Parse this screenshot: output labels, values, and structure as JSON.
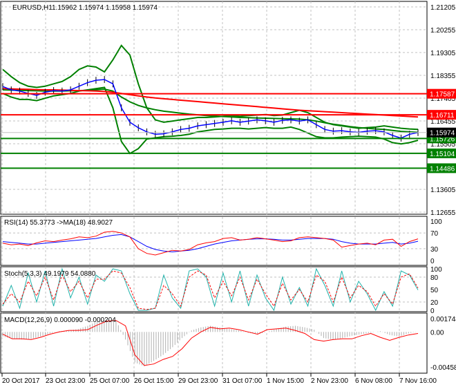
{
  "header": {
    "symbol": "EURUSD,H1",
    "ohlc": "1.15962 1.15974 1.15958 1.15974"
  },
  "chart_data": [
    {
      "type": "line",
      "title": "EURUSD,H1",
      "ylim": [
        1.12655,
        1.21205
      ],
      "yticks": [
        1.21205,
        1.20255,
        1.19305,
        1.18355,
        1.17405,
        1.16455,
        1.15505,
        1.13605,
        1.12655
      ],
      "xlabels": [
        "20 Oct 2017",
        "23 Oct 23:00",
        "25 Oct 07:00",
        "26 Oct 15:00",
        "29 Oct 23:00",
        "31 Oct 07:00",
        "1 Nov 15:00",
        "2 Nov 23:00",
        "6 Nov 08:00",
        "7 Nov 16:00"
      ],
      "close": [
        1.1789,
        1.1775,
        1.177,
        1.176,
        1.1752,
        1.1765,
        1.1772,
        1.177,
        1.1775,
        1.179,
        1.1805,
        1.1815,
        1.1818,
        1.18,
        1.17,
        1.164,
        1.1617,
        1.16,
        1.159,
        1.1592,
        1.16,
        1.161,
        1.1615,
        1.1625,
        1.163,
        1.1635,
        1.164,
        1.1646,
        1.164,
        1.1645,
        1.165,
        1.1646,
        1.164,
        1.1648,
        1.165,
        1.1645,
        1.165,
        1.163,
        1.161,
        1.1603,
        1.1605,
        1.16,
        1.1598,
        1.1603,
        1.1605,
        1.16,
        1.1585,
        1.1574,
        1.159,
        1.1597
      ],
      "bb_upper": [
        1.186,
        1.183,
        1.1805,
        1.179,
        1.1785,
        1.179,
        1.18,
        1.181,
        1.183,
        1.186,
        1.1875,
        1.187,
        1.185,
        1.19,
        1.196,
        1.192,
        1.18,
        1.17,
        1.165,
        1.164,
        1.1645,
        1.165,
        1.1655,
        1.166,
        1.166,
        1.1662,
        1.1665,
        1.1668,
        1.1665,
        1.1668,
        1.167,
        1.1672,
        1.1668,
        1.167,
        1.168,
        1.169,
        1.168,
        1.166,
        1.164,
        1.163,
        1.1625,
        1.162,
        1.1615,
        1.1618,
        1.162,
        1.1625,
        1.162,
        1.1615,
        1.1612,
        1.161
      ],
      "bb_lower": [
        1.176,
        1.1745,
        1.1735,
        1.1735,
        1.173,
        1.174,
        1.175,
        1.1755,
        1.176,
        1.177,
        1.1775,
        1.178,
        1.1785,
        1.17,
        1.156,
        1.151,
        1.153,
        1.157,
        1.1575,
        1.158,
        1.1582,
        1.1585,
        1.159,
        1.16,
        1.1605,
        1.161,
        1.1612,
        1.1615,
        1.1615,
        1.1612,
        1.1615,
        1.1618,
        1.1615,
        1.1615,
        1.162,
        1.161,
        1.1595,
        1.158,
        1.1575,
        1.1575,
        1.1578,
        1.158,
        1.1582,
        1.158,
        1.1578,
        1.157,
        1.1555,
        1.155,
        1.1555,
        1.1565
      ],
      "ma_slow": [
        1.178,
        1.1779,
        1.1778,
        1.1777,
        1.1776,
        1.1775,
        1.1775,
        1.1774,
        1.1773,
        1.1772,
        1.1771,
        1.177,
        1.1768,
        1.1765,
        1.176,
        1.1755,
        1.175,
        1.1745,
        1.1741,
        1.1738,
        1.1735,
        1.1732,
        1.1729,
        1.1726,
        1.1723,
        1.172,
        1.1717,
        1.1714,
        1.1711,
        1.1708,
        1.1705,
        1.1702,
        1.1699,
        1.1696,
        1.1693,
        1.169,
        1.1688,
        1.1686,
        1.1684,
        1.1682,
        1.168,
        1.1678,
        1.1676,
        1.1674,
        1.1672,
        1.167,
        1.1668,
        1.1666,
        1.1664,
        1.1662
      ],
      "ma_green": [
        1.1775,
        1.1774,
        1.1773,
        1.1772,
        1.1771,
        1.177,
        1.177,
        1.177,
        1.1771,
        1.1772,
        1.1773,
        1.1775,
        1.1778,
        1.177,
        1.1745,
        1.1725,
        1.171,
        1.17,
        1.1692,
        1.1686,
        1.1682,
        1.1678,
        1.1674,
        1.1671,
        1.1668,
        1.1666,
        1.1664,
        1.1662,
        1.166,
        1.1659,
        1.1658,
        1.1657,
        1.1656,
        1.1655,
        1.1654,
        1.1653,
        1.165,
        1.1645,
        1.1638,
        1.1632,
        1.1627,
        1.1622,
        1.1618,
        1.1615,
        1.1612,
        1.161,
        1.1606,
        1.1602,
        1.16,
        1.1598
      ],
      "levels": [
        {
          "value": "1.17587",
          "color": "#ff0000"
        },
        {
          "value": "1.16711",
          "color": "#ff0000"
        },
        {
          "value": "1.15726",
          "color": "#008000"
        },
        {
          "value": "1.15104",
          "color": "#008000"
        },
        {
          "value": "1.14486",
          "color": "#008000"
        }
      ],
      "current": {
        "value": "1.15974",
        "color": "#000000"
      }
    },
    {
      "type": "line",
      "title": "RSI(14) 55.3773  ->MA(18) 48.9027",
      "ylim": [
        0,
        100
      ],
      "yticks": [
        "100",
        "70",
        "30",
        "0"
      ],
      "rsi": [
        44,
        40,
        42,
        38,
        45,
        50,
        48,
        52,
        55,
        60,
        58,
        62,
        72,
        74,
        70,
        60,
        30,
        18,
        14,
        20,
        26,
        24,
        28,
        40,
        45,
        48,
        56,
        58,
        52,
        54,
        58,
        55,
        52,
        48,
        50,
        58,
        60,
        58,
        56,
        52,
        34,
        38,
        42,
        44,
        40,
        52,
        54,
        36,
        48,
        55
      ],
      "ma": [
        48,
        46,
        44,
        42,
        42,
        44,
        46,
        48,
        50,
        52,
        54,
        56,
        60,
        64,
        66,
        60,
        48,
        36,
        28,
        24,
        22,
        24,
        26,
        30,
        36,
        42,
        46,
        50,
        52,
        54,
        55,
        55,
        54,
        52,
        52,
        54,
        56,
        56,
        56,
        54,
        48,
        44,
        42,
        42,
        42,
        44,
        46,
        42,
        44,
        49
      ]
    },
    {
      "type": "line",
      "title": "Stoch(5,3,3) 49.1979 54.0880",
      "ylim": [
        0,
        100
      ],
      "yticks": [
        "100",
        "80",
        "50",
        "20",
        "0"
      ],
      "k": [
        10,
        60,
        5,
        90,
        20,
        95,
        10,
        100,
        30,
        80,
        15,
        85,
        70,
        100,
        95,
        40,
        0,
        0,
        5,
        85,
        30,
        5,
        95,
        100,
        80,
        10,
        90,
        20,
        95,
        10,
        85,
        30,
        0,
        80,
        15,
        55,
        10,
        100,
        60,
        10,
        95,
        20,
        70,
        40,
        0,
        45,
        10,
        95,
        85,
        49
      ],
      "d": [
        15,
        40,
        20,
        70,
        35,
        80,
        25,
        85,
        45,
        70,
        30,
        75,
        75,
        95,
        90,
        55,
        5,
        2,
        5,
        60,
        40,
        10,
        80,
        95,
        85,
        30,
        70,
        35,
        80,
        25,
        75,
        40,
        10,
        65,
        25,
        50,
        20,
        85,
        70,
        20,
        80,
        30,
        60,
        45,
        10,
        40,
        15,
        80,
        88,
        54
      ]
    },
    {
      "type": "bar",
      "title": "MACD(12,26,9) 0.000090 -0.000204",
      "ylim": [
        -0.004586,
        0.001748
      ],
      "yticks": [
        "0.001748",
        "0.00",
        "-0.004586"
      ],
      "hist": [
        -0.0006,
        -0.0009,
        -0.001,
        -0.0009,
        -0.0006,
        -0.0002,
        0.0001,
        0.0002,
        0.0004,
        0.0008,
        0.0014,
        0.0016,
        0.0015,
        -0.001,
        -0.004,
        -0.0045,
        -0.0038,
        -0.003,
        -0.002,
        -0.0008,
        0.0002,
        0.0006,
        0.0008,
        0.0006,
        0.0004,
        0.0002,
        -0.0001,
        -0.0003,
        0.0,
        0.0004,
        0.0007,
        0.0008,
        0.0006,
        0.0003,
        -0.0008,
        -0.001,
        -0.0008,
        -0.0005,
        -0.0003,
        -0.0001,
        0.0001,
        -0.0004,
        -0.0006,
        -0.0002,
        0.0001
      ],
      "signal": [
        -0.0003,
        -0.0009,
        -0.0009,
        -0.001,
        -0.0007,
        -0.0003,
        0.0,
        0.0002,
        0.0002,
        0.0003,
        0.0009,
        0.0014,
        0.0015,
        0.0008,
        -0.003,
        -0.0044,
        -0.0042,
        -0.0036,
        -0.0032,
        -0.0022,
        -0.0008,
        0.0,
        0.0006,
        0.0004,
        0.0005,
        0.0003,
        0.0,
        -0.0003,
        0.0003,
        0.0004,
        0.0005,
        0.0002,
        -0.0002,
        -0.001,
        -0.0012,
        -0.001,
        -0.0009,
        -0.0009,
        -0.0005,
        -0.0002,
        -0.0007,
        -0.0011,
        -0.0007,
        -0.0004,
        -0.0002
      ]
    }
  ]
}
